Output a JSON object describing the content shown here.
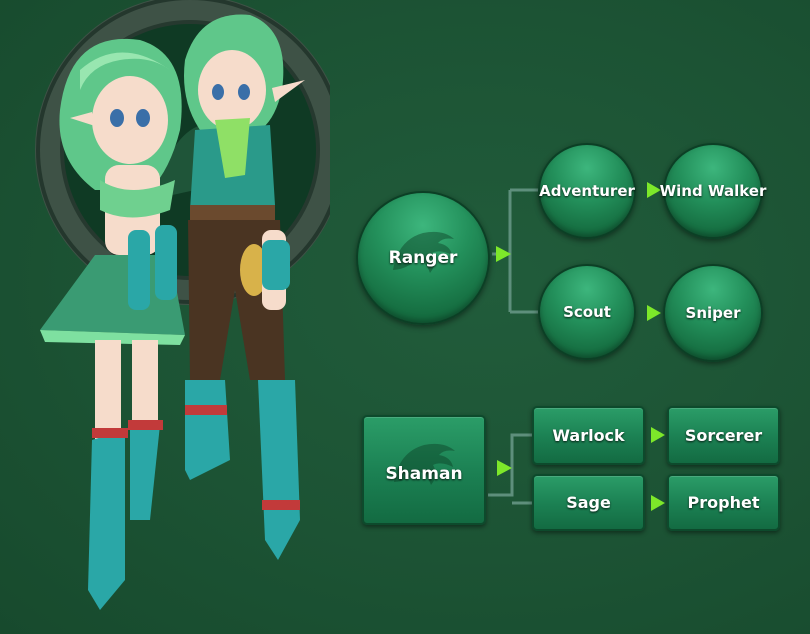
{
  "colors": {
    "background": "#1c5334",
    "node_fill": "#23905b",
    "connector": "#5e8f7c",
    "arrow": "#7de82a"
  },
  "ranger_tree": {
    "base": {
      "label": "Ranger",
      "icon": "wolf-emblem-icon"
    },
    "adventurer": {
      "label": "Adventurer"
    },
    "wind_walker": {
      "label": "Wind Walker"
    },
    "scout": {
      "label": "Scout"
    },
    "sniper": {
      "label": "Sniper"
    }
  },
  "shaman_tree": {
    "base": {
      "label": "Shaman",
      "icon": "wolf-emblem-icon"
    },
    "warlock": {
      "label": "Warlock"
    },
    "sorcerer": {
      "label": "Sorcerer"
    },
    "sage": {
      "label": "Sage"
    },
    "prophet": {
      "label": "Prophet"
    }
  },
  "artwork": {
    "subject": "two-elf-characters",
    "icon": "stone-ring-emblem"
  }
}
